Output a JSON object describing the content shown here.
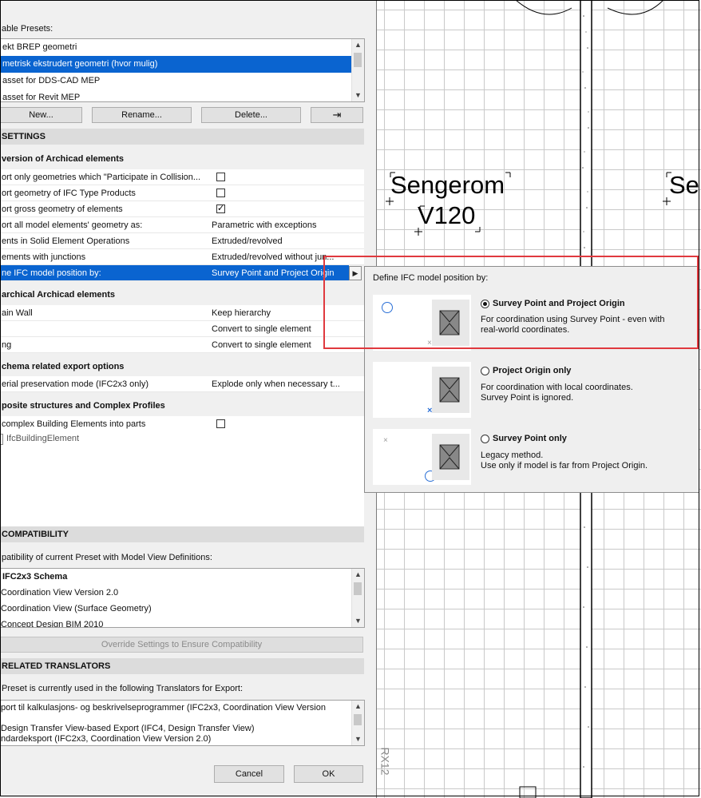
{
  "presets": {
    "header": "able Presets:",
    "items": [
      {
        "label": "ekt BREP geometri",
        "selected": false
      },
      {
        "label": "metrisk ekstrudert geometri (hvor mulig)",
        "selected": true
      },
      {
        "label": "asset for DDS-CAD MEP",
        "selected": false
      },
      {
        "label": "asset for Revit MEP",
        "selected": false
      }
    ],
    "buttons": {
      "new": "New...",
      "rename": "Rename...",
      "delete": "Delete..."
    }
  },
  "settings": {
    "header": "SETTINGS",
    "conversion_title": "version of Archicad elements",
    "conversion_rows": [
      {
        "label": "ort only geometries which \"Participate in Collision...",
        "type": "checkbox",
        "checked": false
      },
      {
        "label": "ort geometry of IFC Type Products",
        "type": "checkbox",
        "checked": false
      },
      {
        "label": "ort gross geometry of elements",
        "type": "checkbox",
        "checked": true
      },
      {
        "label": "ort all model elements' geometry as:",
        "type": "value",
        "value": "Parametric with exceptions"
      },
      {
        "label": "ents in Solid Element Operations",
        "type": "value",
        "value": "Extruded/revolved"
      },
      {
        "label": "ements with junctions",
        "type": "value",
        "value": "Extruded/revolved without jun..."
      },
      {
        "label": "ne IFC model position by:",
        "type": "value",
        "value": "Survey Point and Project Origin",
        "selected": true
      }
    ],
    "hierarchical_title": "archical Archicad elements",
    "hierarchical_rows": [
      {
        "label": "ain Wall",
        "value": "Keep hierarchy"
      },
      {
        "label": "",
        "value": "Convert to single element"
      },
      {
        "label": "ng",
        "value": "Convert to single element"
      }
    ],
    "schema_title": "chema related export options",
    "schema_rows": [
      {
        "label": "erial preservation mode (IFC2x3 only)",
        "value": "Explode only when necessary t..."
      }
    ],
    "composite_title": "posite structures and Complex Profiles",
    "composite_rows": [
      {
        "label": "complex Building Elements into parts",
        "checked": false
      }
    ],
    "tree_item": "IfcBuildingElement"
  },
  "compatibility": {
    "header": "COMPATIBILITY",
    "intro": "patibility of current Preset with Model View Definitions:",
    "items": [
      {
        "label": "IFC2x3 Schema",
        "bold": true
      },
      {
        "label": "Coordination View Version 2.0",
        "bold": false
      },
      {
        "label": "Coordination View (Surface Geometry)",
        "bold": false
      },
      {
        "label": "Concept Design BIM 2010",
        "bold": false
      }
    ],
    "override_button": "Override Settings to Ensure Compatibility"
  },
  "translators": {
    "header": "RELATED TRANSLATORS",
    "intro": "Preset is currently used in the following Translators for Export:",
    "items": [
      "port til kalkulasjons- og beskrivelseprogrammer (IFC2x3, Coordination View Version",
      "",
      "Design Transfer View-based Export (IFC4, Design Transfer View)",
      "ndardeksport (IFC2x3, Coordination View Version 2.0)"
    ]
  },
  "footer": {
    "cancel": "Cancel",
    "ok": "OK"
  },
  "popup": {
    "title": "Define IFC model position by:",
    "options": [
      {
        "title": "Survey Point and Project Origin",
        "selected": true,
        "desc1": "For coordination using Survey Point - even with",
        "desc2": "real-world coordinates."
      },
      {
        "title": "Project Origin only",
        "selected": false,
        "desc1": "For coordination with local coordinates.",
        "desc2": "Survey Point is ignored."
      },
      {
        "title": "Survey Point only",
        "selected": false,
        "desc1": "Legacy method.",
        "desc2": "Use only if model is far from Project Origin."
      }
    ]
  },
  "plan": {
    "room1_name": "Sengerom",
    "room1_number": "V120",
    "room2_name": "Se",
    "side_text": "RX12"
  },
  "colors": {
    "selection": "#0a64d0",
    "highlight": "#e0393e",
    "marker_blue": "#2a6fd6"
  }
}
